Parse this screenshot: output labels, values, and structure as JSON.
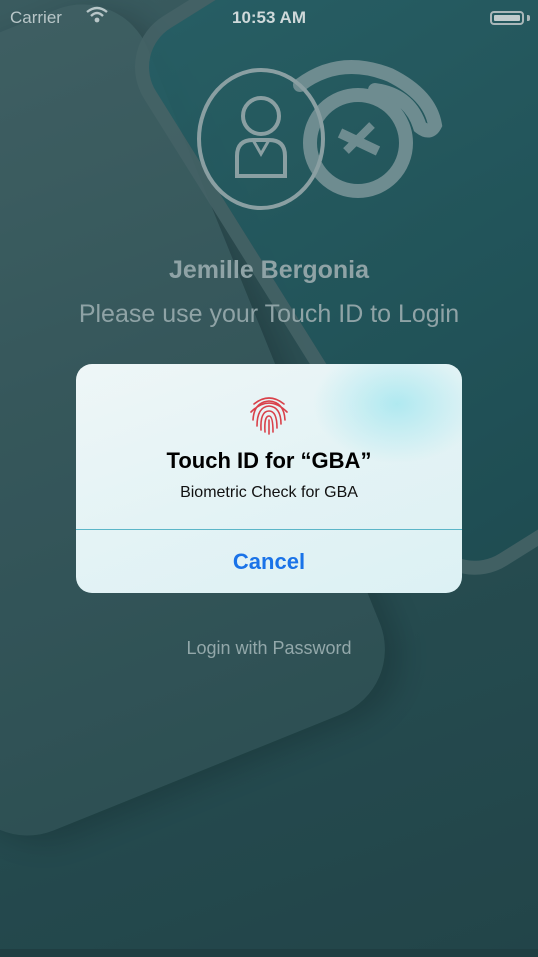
{
  "status_bar": {
    "carrier": "Carrier",
    "time": "10:53 AM"
  },
  "profile": {
    "name": "Jemille Bergonia",
    "instruction": "Please use your Touch ID to Login"
  },
  "alert": {
    "icon": "fingerprint-icon",
    "title": "Touch ID for “GBA”",
    "message": "Biometric Check for GBA",
    "cancel_label": "Cancel"
  },
  "login_with_password_label": "Login with Password",
  "colors": {
    "accent": "#1a73e8",
    "background": "#2f5a5f",
    "fingerprint": "#d9414a"
  }
}
